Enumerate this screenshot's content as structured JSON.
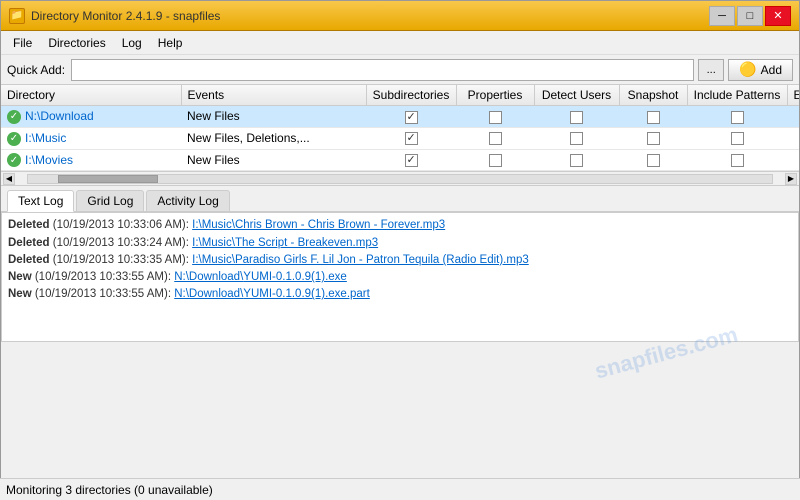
{
  "title_bar": {
    "title": "Directory Monitor 2.4.1.9 - snapfiles",
    "icon": "📁",
    "min": "─",
    "max": "□",
    "close": "✕"
  },
  "menu": {
    "items": [
      "File",
      "Directories",
      "Log",
      "Help"
    ]
  },
  "quick_add": {
    "label": "Quick Add:",
    "input_value": "",
    "input_placeholder": "",
    "browse_label": "...",
    "add_label": "Add"
  },
  "table": {
    "columns": [
      "Directory",
      "Events",
      "Subdirectories",
      "Properties",
      "Detect Users",
      "Snapshot",
      "Include Patterns",
      "Exclude Patterns"
    ],
    "rows": [
      {
        "status": "ok",
        "directory": "N:\\Download",
        "events": "New Files",
        "subdirs": true,
        "properties": false,
        "detect_users": false,
        "snapshot": false,
        "include": false,
        "exclude": false
      },
      {
        "status": "ok",
        "directory": "I:\\Music",
        "events": "New Files, Deletions,...",
        "subdirs": true,
        "properties": false,
        "detect_users": false,
        "snapshot": false,
        "include": false,
        "exclude": false
      },
      {
        "status": "ok",
        "directory": "I:\\Movies",
        "events": "New Files",
        "subdirs": true,
        "properties": false,
        "detect_users": false,
        "snapshot": false,
        "include": false,
        "exclude": false
      }
    ]
  },
  "tabs": {
    "items": [
      "Text Log",
      "Grid Log",
      "Activity Log"
    ],
    "active": 0
  },
  "log": {
    "entries": [
      {
        "type": "Deleted",
        "meta": " (10/19/2013 10:33:06 AM): ",
        "path_before": "I:\\Music\\",
        "path_after": "Chris Brown - Chris Brown - Forever.mp3",
        "path_base": "I:\\Music\\"
      },
      {
        "type": "Deleted",
        "meta": " (10/19/2013 10:33:24 AM): ",
        "path_before": "I:\\Music\\",
        "path_after": "The Script - Breakeven.mp3",
        "path_base": "I:\\Music\\"
      },
      {
        "type": "Deleted",
        "meta": " (10/19/2013 10:33:35 AM): ",
        "path_before": "I:\\Music\\",
        "path_after": "Paradiso Girls F. Lil Jon - Patron Tequila (Radio Edit).mp3",
        "path_base": "I:\\Music\\"
      },
      {
        "type": "New",
        "meta": " (10/19/2013 10:33:55 AM): ",
        "path_before": "N:\\Download\\",
        "path_after": "YUMI-0.1.0.9(1).exe",
        "path_base": "N:\\Download\\"
      },
      {
        "type": "New",
        "meta": " (10/19/2013 10:33:55 AM): ",
        "path_before": "N:\\Download\\",
        "path_after": "YUMI-0.1.0.9(1).exe.part",
        "path_base": "N:\\Download\\"
      }
    ]
  },
  "status_bar": {
    "text": "Monitoring 3 directories (0 unavailable)"
  },
  "watermark": {
    "line1": "snapfiles",
    "line2": ".com"
  }
}
